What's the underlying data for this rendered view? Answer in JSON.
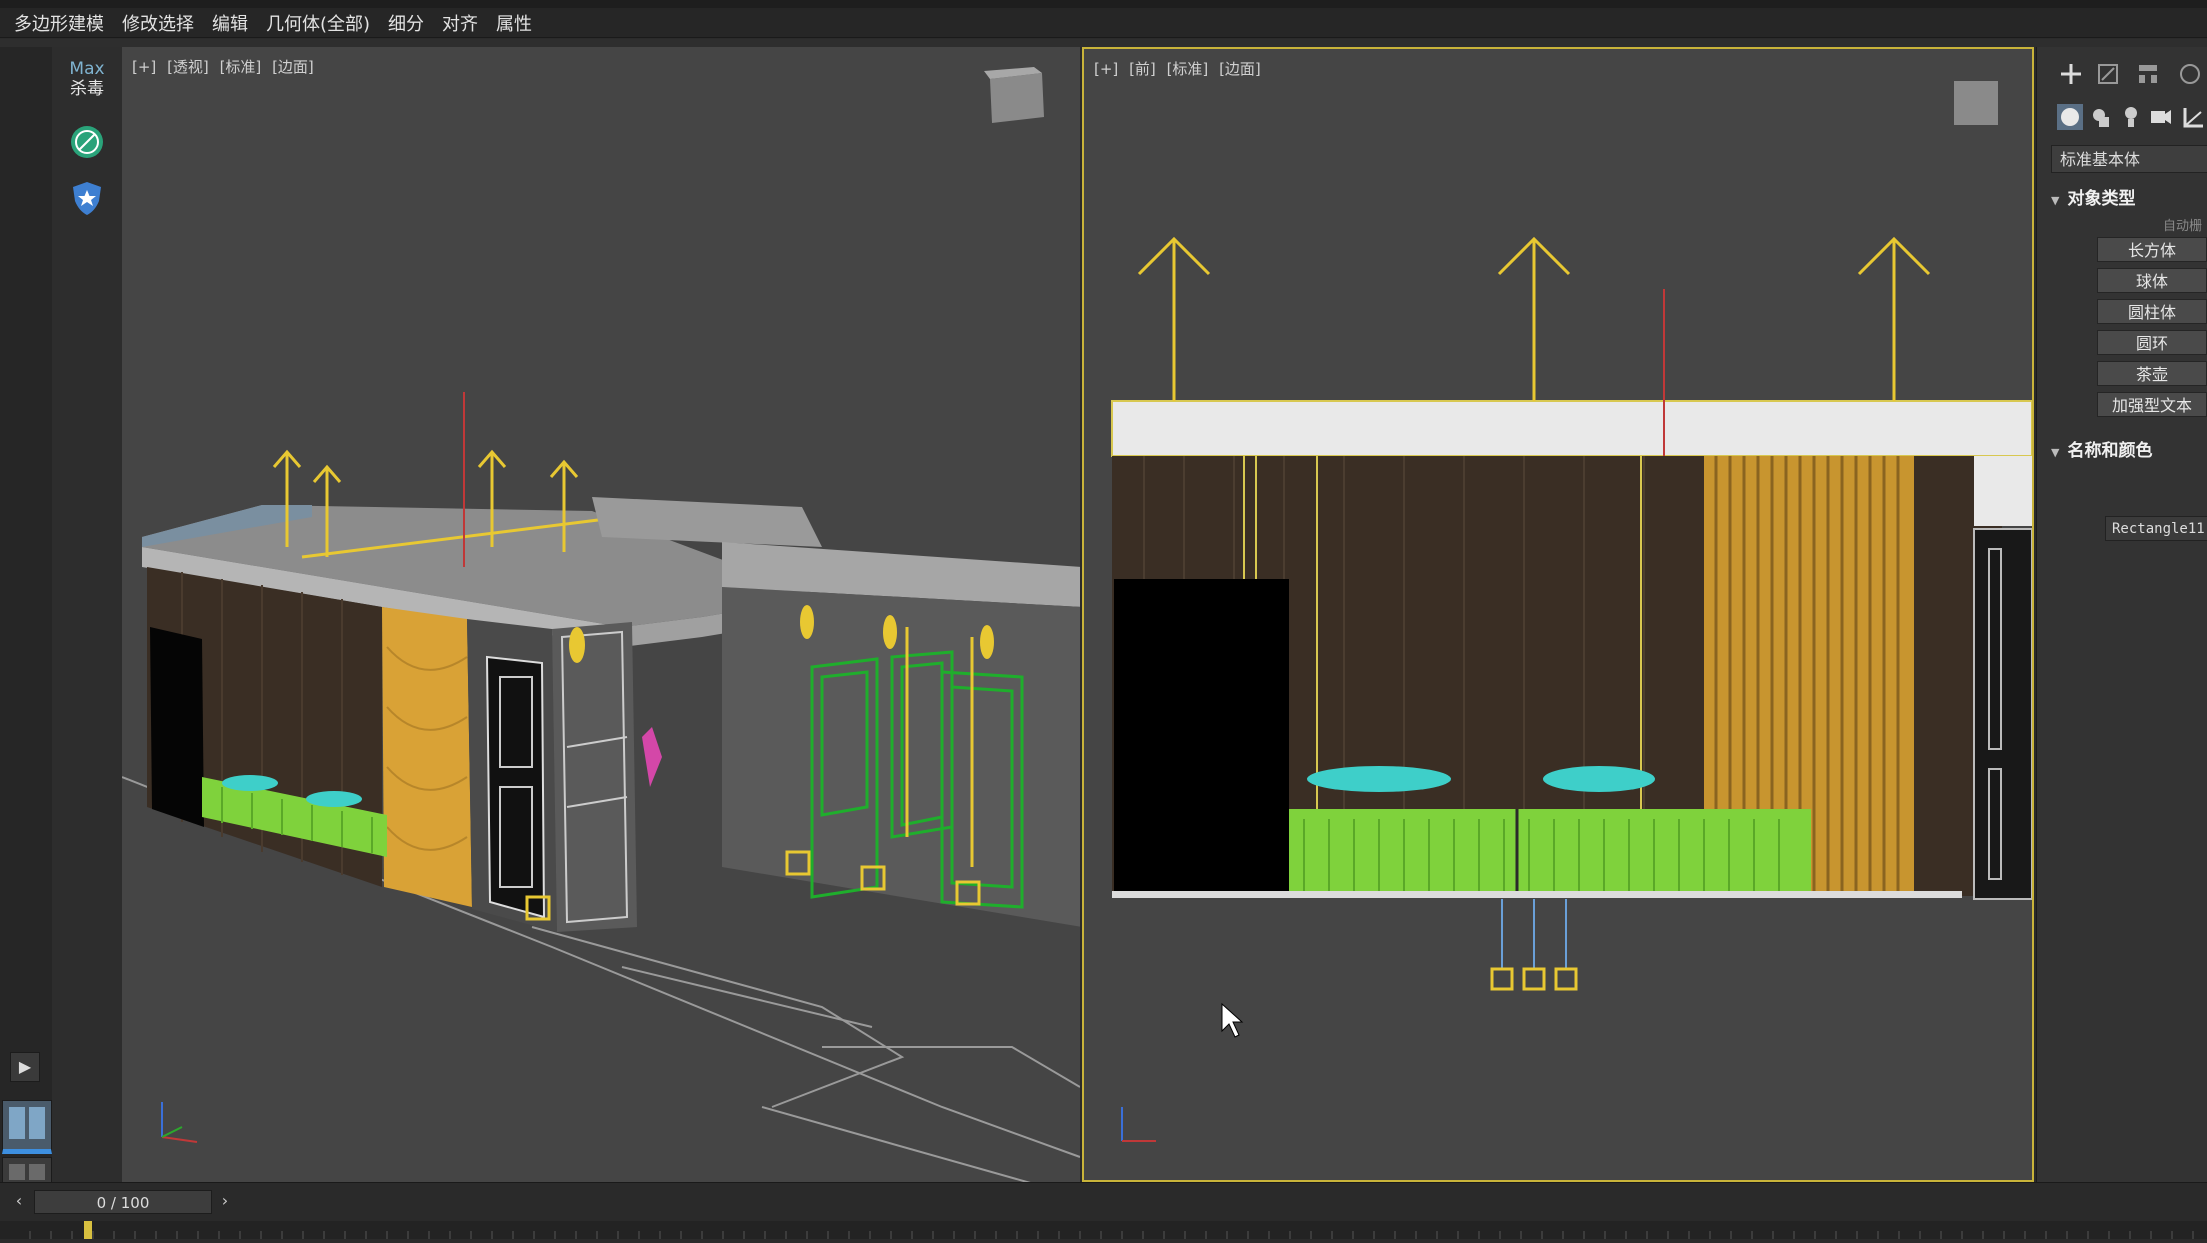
{
  "menu": {
    "items": [
      {
        "label": "多边形建模"
      },
      {
        "label": "修改选择"
      },
      {
        "label": "编辑"
      },
      {
        "label": "几何体(全部)"
      },
      {
        "label": "细分"
      },
      {
        "label": "对齐"
      },
      {
        "label": "属性"
      }
    ]
  },
  "left_toolbar": {
    "app_badge_top": "Max",
    "app_badge_bottom": "杀毒",
    "icons": [
      "antivirus-scan-icon",
      "shield-icon"
    ]
  },
  "viewports": {
    "left": {
      "labels": [
        "[+]",
        "[透视]",
        "[标准]",
        "[边面]"
      ]
    },
    "right": {
      "labels": [
        "[+]",
        "[前]",
        "[标准]",
        "[边面]"
      ]
    }
  },
  "command_panel": {
    "top_icons": [
      "create-plus-icon",
      "modify-icon",
      "hierarchy-icon",
      "motion-icon"
    ],
    "category_icons": [
      "geometry-sphere-icon",
      "shapes-icon",
      "lights-icon",
      "cameras-icon",
      "helpers-icon"
    ],
    "dropdown_value": "标准基本体",
    "object_type_title": "对象类型",
    "autogrid_label": "自动栅",
    "object_buttons": [
      "长方体",
      "球体",
      "圆柱体",
      "圆环",
      "茶壶",
      "加强型文本"
    ],
    "name_color_title": "名称和颜色",
    "object_name": "Rectangle11"
  },
  "timeline": {
    "frame_display": "0 / 100"
  },
  "colors": {
    "selected_viewport_border": "#c9b43a",
    "gizmo_yellow": "#e8c832",
    "plant_green": "#7fd23c",
    "cushion_cyan": "#3ecfc9",
    "door_green": "#1fae2c",
    "wood_dark": "#3a2e24",
    "slat_gold": "#d9a236"
  }
}
